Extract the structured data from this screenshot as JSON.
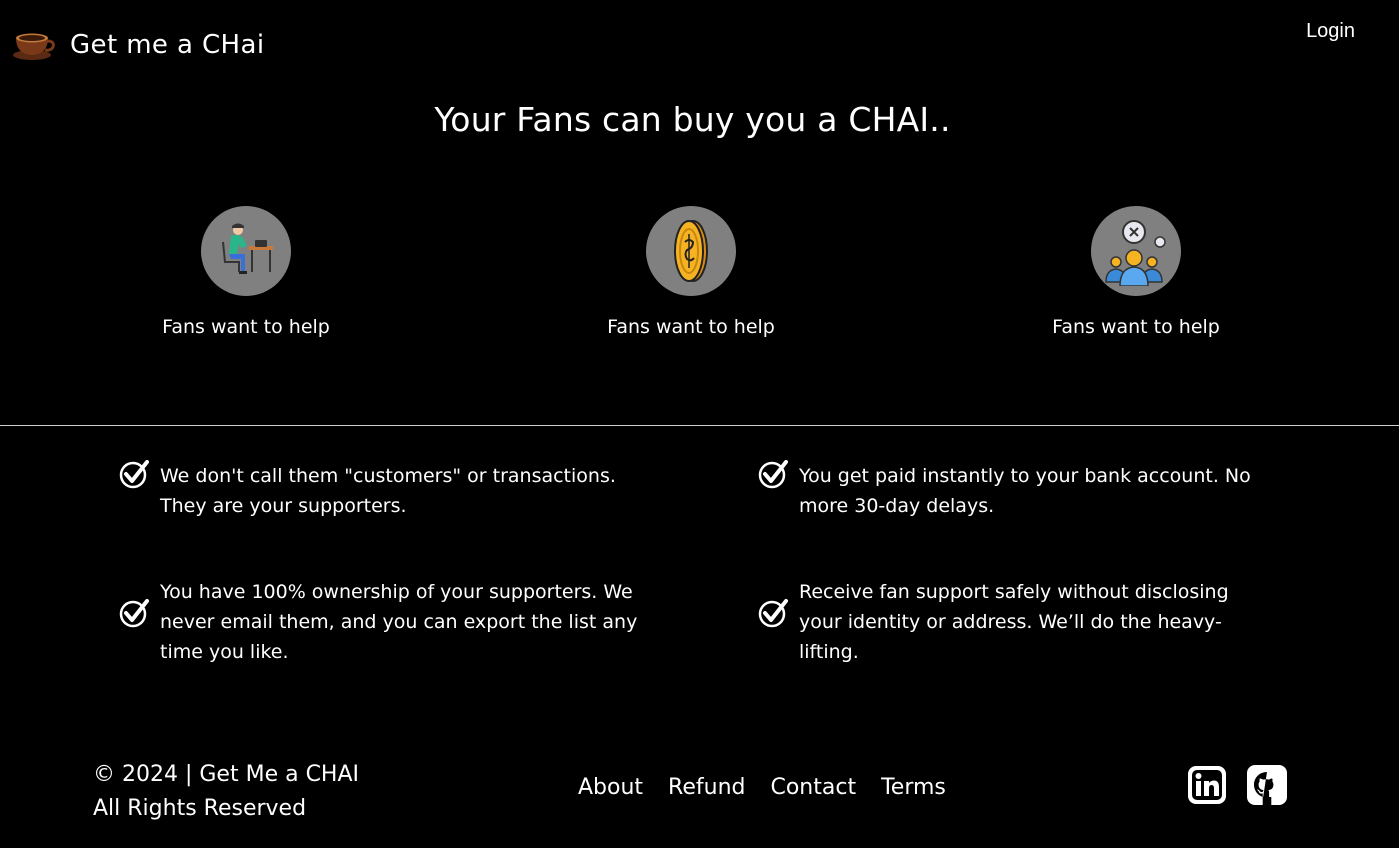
{
  "header": {
    "brand_name": "Get me a CHai",
    "brand_icon": "coffee-cup-icon",
    "login_label": "Login"
  },
  "hero": {
    "title": "Your Fans can buy you a CHAI.."
  },
  "features": [
    {
      "icon": "person-at-desk-icon",
      "label": "Fans want to help"
    },
    {
      "icon": "gold-coin-icon",
      "label": "Fans want to help"
    },
    {
      "icon": "community-group-icon",
      "label": "Fans want to help"
    }
  ],
  "benefits": [
    {
      "icon": "check-circle-icon",
      "text": "We don't call them \"customers\" or transactions. They are your supporters."
    },
    {
      "icon": "check-circle-icon",
      "text": "You get paid instantly to your bank account. No more 30-day delays."
    },
    {
      "icon": "check-circle-icon",
      "text": "You have 100% ownership of your supporters. We never email them, and you can export the list any time you like."
    },
    {
      "icon": "check-circle-icon",
      "text": "Receive fan support safely without disclosing your identity or address. We’ll do the heavy-lifting."
    }
  ],
  "footer": {
    "copyright_line1": "© 2024 | Get Me a CHAI",
    "copyright_line2": "All Rights Reserved",
    "links": [
      "About",
      "Refund",
      "Contact",
      "Terms"
    ],
    "social": [
      "linkedin-icon",
      "github-icon"
    ]
  },
  "colors": {
    "background": "#000000",
    "text": "#ffffff",
    "icon_circle": "#808080",
    "coin": "#f5b324",
    "divider": "#cfcfcf"
  }
}
